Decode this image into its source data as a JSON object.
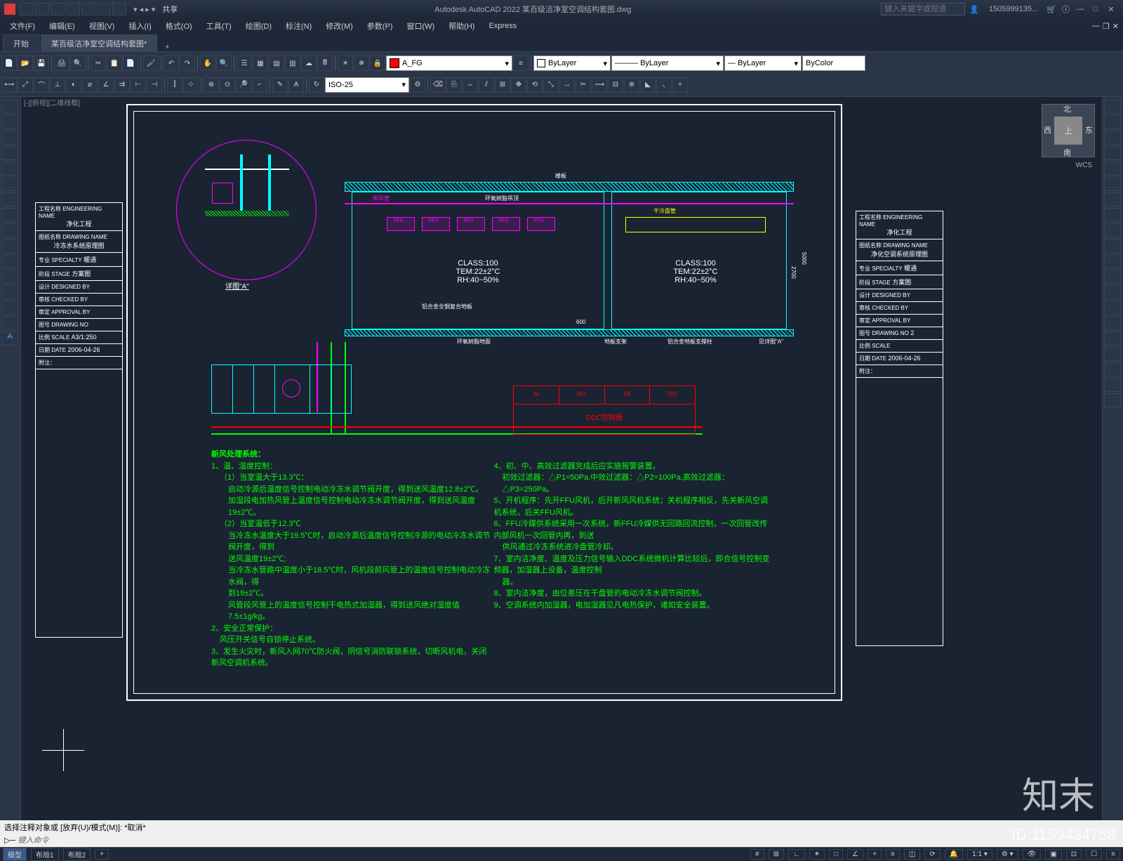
{
  "title": "Autodesk AutoCAD 2022   某百级洁净室空调结构套图.dwg",
  "share": "共享",
  "search_ph": "键入关键字或短语",
  "user": "1505999135...",
  "menu": [
    "文件(F)",
    "编辑(E)",
    "视图(V)",
    "插入(I)",
    "格式(O)",
    "工具(T)",
    "绘图(D)",
    "标注(N)",
    "修改(M)",
    "参数(P)",
    "窗口(W)",
    "帮助(H)",
    "Express"
  ],
  "tabs": {
    "t1": "开始",
    "t2": "某百级洁净室空调结构套图*",
    "plus": "+"
  },
  "ribbon": {
    "layer_name": "A_FG",
    "linetype": "ByLayer",
    "lineweight": "ByLayer",
    "lineweight2": "ByLayer",
    "color": "ByColor",
    "dimstyle": "ISO-25",
    "bylayer": "ByLayer"
  },
  "viewcube": {
    "top": "上",
    "n": "北",
    "s": "南",
    "e": "东",
    "w": "西",
    "wcs": "WCS"
  },
  "modelspace": "[-][俯视][二维线框]",
  "titleblock": {
    "eng_name_lbl": "工程名称\nENGINEERING NAME",
    "eng_name": "净化工程",
    "dwg_name_lbl": "图纸名称\nDRAWING NAME",
    "dwg_name_l": "冷冻水系统原理图",
    "dwg_name_r": "净化空调系统原理图",
    "specialty_lbl": "专业\nSPECIALTY",
    "specialty": "暖通",
    "stage_lbl": "阶段\nSTAGE",
    "stage": "方案图",
    "designed_lbl": "设计\nDESIGNED BY",
    "checked_lbl": "审核\nCHECKED BY",
    "approval_lbl": "审定\nAPPROVAL BY",
    "dwgno_lbl": "图号\nDRAWING NO",
    "dwgno_r": "2",
    "scale_lbl": "比例\nSCALE",
    "scale": "A3/1:250",
    "date_lbl": "日期\nDATE",
    "date": "2006-04-26",
    "notes_lbl": "附注："
  },
  "drawing": {
    "detail_label": "详图\"A\"",
    "slab_label": "楼板",
    "duct_label": "新风管",
    "return_label": "环氧树脂吊顶",
    "coil_label": "干冷盘管",
    "ffu": "FFU",
    "room1": {
      "class": "CLASS:100",
      "tem": "TEM:22±2°C",
      "rh": "RH:40~50%"
    },
    "room2": {
      "class": "CLASS:100",
      "tem": "TEM:22±2°C",
      "rh": "RH:40~50%"
    },
    "floor1": "铝合金全钢复合地板",
    "env_floor": "环氧树脂地面",
    "support": "地板支架",
    "support2": "铝合金地板支撑柱",
    "detail_ref": "见详图\"A\"",
    "dim1": "5000",
    "dim2": "2700",
    "dim3": "600",
    "ddc": {
      "ai": "AI",
      "ao": "AO",
      "di": "DI",
      "do": "DO",
      "title": "DDC控制器"
    },
    "notes_title": "新风处理系统：",
    "notes": [
      "1、温、湿度控制：",
      "（1）当室温大于13.3℃：",
      "启动冷源后温度信号控制电动冷冻水调节阀开度，得到送风温度12.8±2℃。",
      "加湿段电加热风管上温度信号控制电动冷冻水调节阀开度，得到送风温度19±2℃。",
      "（2）当室温低于12.3℃",
      "当冷冻水温度大于19.5℃时，启动冷源后温度信号控制冷源的电动冷冻水调节阀开度，得到",
      "送风温度19±2℃;",
      "当冷冻水管路中温度小于18.5℃时，风机段前风管上的温度信号控制电动冷冻水阀，得",
      "到19±2℃。",
      "风管段风管上的温度信号控制干电热式加湿器，得到送风绝对湿度值7.5±1g/kg。",
      "2、安全正常保护：",
      "风压开关信号自锁停止系统。",
      "3、发生火灾时，新风入网70℃防火阀，阴信号消防联锁系统，切断风机电，关闭新风空调机系统。",
      "4、初、中、高效过滤器完成后应实施报警装置。",
      "初效过滤器：△P1=50Pa,中效过滤器：△P2=100Pa,高效过滤器：△P3=250Pa。",
      "5、开机程序：先开FFU风机，后开新风风机系统；关机程序相反，先关新风空调机系统，后关FFU风机。",
      "6、FFU冷媒供系统采用一次系统，新FFU冷媒供无回路回流控制，一次回管改传内部风机一次回管内再，到送",
      "供风通过冷冻系统进冷盘管冷却。",
      "7、室内洁净度、温度及压力信号输入DDC系统微机计算比较后，即合信号控制变频器，加湿器上设备，温度控制",
      "器。",
      "8、室内洁净度，由位差压在干盘管的电动冷冻水调节阀控制。",
      "9、空调系统内加湿器，电加湿器见凡电热保护，诸如安全装置。"
    ]
  },
  "cmdline": {
    "l1": "选择注释对象或 [放弃(U)/模式(M)]: *取消*",
    "l2_prefix": "▷─",
    "l2": "键入命令"
  },
  "status": {
    "model": "模型",
    "layout1": "布局1",
    "layout2": "布局2"
  },
  "watermark": {
    "brand": "知末",
    "id": "ID:1159434758"
  }
}
